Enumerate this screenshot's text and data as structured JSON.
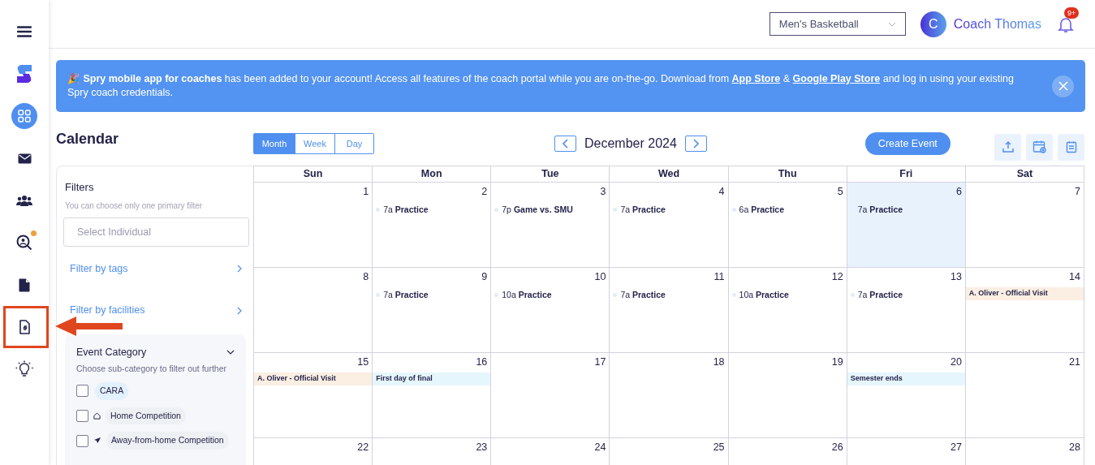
{
  "sidebar": {
    "items": [
      {
        "kind": "menu",
        "selected": false
      },
      {
        "kind": "logo",
        "selected": false
      },
      {
        "kind": "dashboard",
        "selected": true
      },
      {
        "kind": "mail",
        "selected": false
      },
      {
        "kind": "team",
        "selected": false
      },
      {
        "kind": "scout",
        "selected": false,
        "badge": true
      },
      {
        "kind": "document",
        "selected": false
      },
      {
        "kind": "signed-document",
        "selected": false,
        "highlighted": true
      },
      {
        "kind": "idea",
        "selected": false
      }
    ]
  },
  "header": {
    "team_select": "Men's Basketball",
    "avatar_initial": "C",
    "user_name": "Coach Thomas",
    "notification_count": "9+"
  },
  "banner": {
    "message": "🎉 **Spry mobile app for coaches** has been added to your account! Access all features of the coach portal while you are on-the-go. Download from ",
    "link_1": "App Store",
    "joiner": " & ",
    "link_2": "Google Play Store",
    "message_end": " and log in using your existing Spry coach credentials."
  },
  "page_title": "Calendar",
  "view_tabs": [
    {
      "label": "Month",
      "selected": true
    },
    {
      "label": "Week",
      "selected": false
    },
    {
      "label": "Day",
      "selected": false
    }
  ],
  "month_label": "December 2024",
  "create_button": "Create Event",
  "filters": {
    "title": "Filters",
    "hint": "You can choose only one primary filter",
    "individual_placeholder": "Select Individual",
    "links": [
      "Filter by tags",
      "Filter by facilities"
    ],
    "category": {
      "title": "Event Category",
      "expanded": true,
      "hint": "Choose sub-category to filter out further",
      "options": [
        {
          "label": "CARA",
          "kind": "plain",
          "checked": false,
          "color": "#e3f0fd"
        },
        {
          "label": "Home Competition",
          "kind": "home",
          "checked": false,
          "color": "#eef0f4"
        },
        {
          "label": "Away-from-home Competition",
          "kind": "away",
          "checked": false,
          "color": "#eef0f4"
        }
      ]
    }
  },
  "calendar": {
    "weekdays": [
      "Sun",
      "Mon",
      "Tue",
      "Wed",
      "Thu",
      "Fri",
      "Sat"
    ],
    "weeks": [
      [
        {
          "day": "1",
          "today": false
        },
        {
          "day": "2",
          "today": false,
          "events": [
            {
              "kind": "timed",
              "time": "7a",
              "title": "Practice"
            }
          ]
        },
        {
          "day": "3",
          "today": false,
          "events": [
            {
              "kind": "timed",
              "time": "7p",
              "title": "Game vs. SMU"
            }
          ]
        },
        {
          "day": "4",
          "today": false,
          "events": [
            {
              "kind": "timed",
              "time": "7a",
              "title": "Practice"
            }
          ]
        },
        {
          "day": "5",
          "today": false,
          "events": [
            {
              "kind": "timed",
              "time": "6a",
              "title": "Practice"
            }
          ]
        },
        {
          "day": "6",
          "today": true,
          "events": [
            {
              "kind": "timed",
              "time": "7a",
              "title": "Practice"
            }
          ]
        },
        {
          "day": "7",
          "today": false
        }
      ],
      [
        {
          "day": "8",
          "today": false
        },
        {
          "day": "9",
          "today": false,
          "events": [
            {
              "kind": "timed",
              "time": "7a",
              "title": "Practice"
            }
          ]
        },
        {
          "day": "10",
          "today": false,
          "events": [
            {
              "kind": "timed",
              "time": "10a",
              "title": "Practice"
            }
          ]
        },
        {
          "day": "11",
          "today": false,
          "events": [
            {
              "kind": "timed",
              "time": "7a",
              "title": "Practice"
            }
          ]
        },
        {
          "day": "12",
          "today": false,
          "events": [
            {
              "kind": "timed",
              "time": "10a",
              "title": "Practice"
            }
          ]
        },
        {
          "day": "13",
          "today": false,
          "events": [
            {
              "kind": "timed",
              "time": "7a",
              "title": "Practice"
            }
          ]
        },
        {
          "day": "14",
          "today": false,
          "events": [
            {
              "kind": "allday",
              "title": "A. Oliver - Official Visit",
              "color": "#fbeee2"
            }
          ]
        }
      ],
      [
        {
          "day": "15",
          "today": false,
          "events": [
            {
              "kind": "allday",
              "title": "A. Oliver - Official Visit",
              "color": "#fbeee2"
            }
          ]
        },
        {
          "day": "16",
          "today": false,
          "events": [
            {
              "kind": "allday",
              "title": "First day of final",
              "color": "#e6f6fd"
            }
          ]
        },
        {
          "day": "17",
          "today": false
        },
        {
          "day": "18",
          "today": false
        },
        {
          "day": "19",
          "today": false
        },
        {
          "day": "20",
          "today": false,
          "events": [
            {
              "kind": "allday",
              "title": "Semester ends",
              "color": "#e6f6fd"
            }
          ]
        },
        {
          "day": "21",
          "today": false
        }
      ],
      [
        {
          "day": "22",
          "today": false
        },
        {
          "day": "23",
          "today": false
        },
        {
          "day": "24",
          "today": false
        },
        {
          "day": "25",
          "today": false
        },
        {
          "day": "26",
          "today": false
        },
        {
          "day": "27",
          "today": false
        },
        {
          "day": "28",
          "today": false
        }
      ]
    ]
  }
}
